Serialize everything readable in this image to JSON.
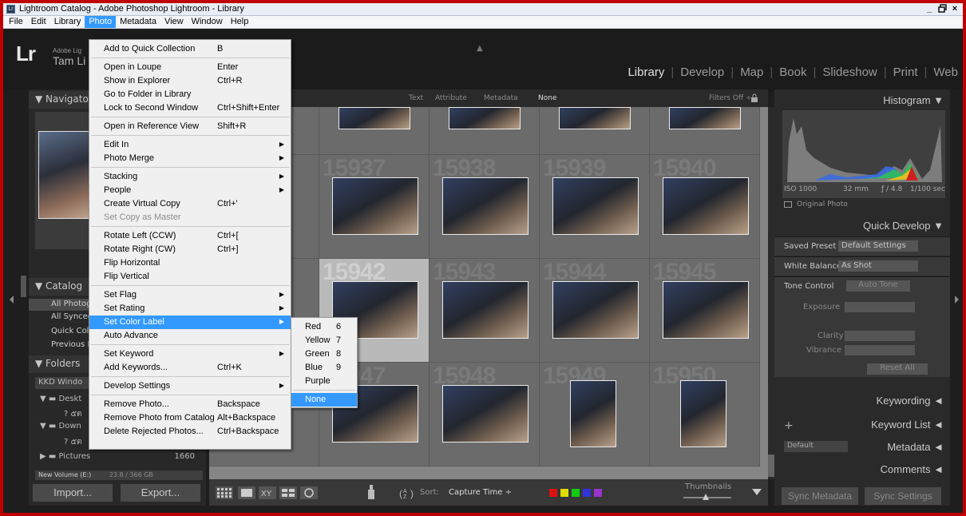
{
  "window": {
    "title": "Lightroom Catalog - Adobe Photoshop Lightroom - Library",
    "icon": "Lr",
    "controls": [
      "_",
      "×"
    ]
  },
  "menubar": [
    "File",
    "Edit",
    "Library",
    "Photo",
    "Metadata",
    "View",
    "Window",
    "Help"
  ],
  "identity": {
    "logo": "Lr",
    "line1": "Adobe Lig",
    "line2": "Tam Li"
  },
  "modules": [
    "Library",
    "Develop",
    "Map",
    "Book",
    "Slideshow",
    "Print",
    "Web"
  ],
  "left": {
    "navigator": "▼ Navigato",
    "catalog_title": "▼ Catalog",
    "catalog_items": [
      "All Photog",
      "All Synced",
      "Quick Colle",
      "Previous In"
    ],
    "folders_title": "▼ Folders",
    "folders": [
      {
        "label": "KKD Windo"
      },
      {
        "label": "▼ ▬ Deskt"
      },
      {
        "label": "? ๕ต"
      },
      {
        "label": "▼ ▬ Down"
      },
      {
        "label": "? ๕ต"
      },
      {
        "label": "▶ ▬ Pictures",
        "count": "1660"
      }
    ],
    "drive": {
      "label": "New Volume (E:)",
      "size": "23.8 / 366 GB"
    },
    "import_btn": "Import...",
    "export_btn": "Export..."
  },
  "filterbar": {
    "items": [
      "Text",
      "Attribute",
      "Metadata",
      "None"
    ],
    "filters": "Filters Off ÷"
  },
  "grid": {
    "rows": [
      [
        "15937",
        "15938",
        "15939",
        "15940"
      ],
      [
        "15942",
        "15943",
        "15944",
        "15945"
      ],
      [
        "15947",
        "15948",
        "15949",
        "15950"
      ]
    ],
    "selected": "15942"
  },
  "toolbar": {
    "sort_label": "Sort:",
    "sort_value": "Capture Time ÷",
    "thumbnails_label": "Thumbnails",
    "swatches": [
      "#d11",
      "#dd0",
      "#1c1",
      "#33d",
      "#93c"
    ]
  },
  "right": {
    "histogram": "Histogram ▼",
    "exif": [
      "ISO 1000",
      "32 mm",
      "ƒ / 4.8",
      "1/100 sec"
    ],
    "original_photo": "Original Photo",
    "quick_develop": "Quick Develop ▼",
    "saved_preset_label": "Saved Preset",
    "saved_preset_value": "Default Settings",
    "wb_label": "White Balance",
    "wb_value": "As Shot",
    "tone_label": "Tone Control",
    "auto_tone": "Auto Tone",
    "exposure": "Exposure",
    "clarity": "Clarity",
    "vibrance": "Vibrance",
    "reset": "Reset All",
    "keywording": "Keywording ◄",
    "keyword_list": "Keyword List ◄",
    "metadata_preset": "Default",
    "metadata": "Metadata ◄",
    "comments": "Comments ◄",
    "sync_metadata": "Sync Metadata",
    "sync_settings": "Sync Settings"
  },
  "photo_menu": [
    {
      "label": "Add to Quick Collection",
      "sc": "B"
    },
    {
      "sep": true
    },
    {
      "label": "Open in Loupe",
      "sc": "Enter"
    },
    {
      "label": "Show in Explorer",
      "sc": "Ctrl+R"
    },
    {
      "label": "Go to Folder in Library"
    },
    {
      "label": "Lock to Second Window",
      "sc": "Ctrl+Shift+Enter"
    },
    {
      "sep": true
    },
    {
      "label": "Open in Reference View",
      "sc": "Shift+R"
    },
    {
      "sep": true
    },
    {
      "label": "Edit In",
      "sub": true
    },
    {
      "label": "Photo Merge",
      "sub": true
    },
    {
      "sep": true
    },
    {
      "label": "Stacking",
      "sub": true
    },
    {
      "label": "People",
      "sub": true
    },
    {
      "label": "Create Virtual Copy",
      "sc": "Ctrl+'"
    },
    {
      "label": "Set Copy as Master",
      "disabled": true
    },
    {
      "sep": true
    },
    {
      "label": "Rotate Left (CCW)",
      "sc": "Ctrl+["
    },
    {
      "label": "Rotate Right (CW)",
      "sc": "Ctrl+]"
    },
    {
      "label": "Flip Horizontal"
    },
    {
      "label": "Flip Vertical"
    },
    {
      "sep": true
    },
    {
      "label": "Set Flag",
      "sub": true
    },
    {
      "label": "Set Rating",
      "sub": true
    },
    {
      "label": "Set Color Label",
      "sub": true,
      "hl": true
    },
    {
      "label": "Auto Advance"
    },
    {
      "sep": true
    },
    {
      "label": "Set Keyword",
      "sub": true
    },
    {
      "label": "Add Keywords...",
      "sc": "Ctrl+K"
    },
    {
      "sep": true
    },
    {
      "label": "Develop Settings",
      "sub": true
    },
    {
      "sep": true
    },
    {
      "label": "Remove Photo...",
      "sc": "Backspace"
    },
    {
      "label": "Remove Photo from Catalog",
      "sc": "Alt+Backspace"
    },
    {
      "label": "Delete Rejected Photos...",
      "sc": "Ctrl+Backspace"
    }
  ],
  "color_submenu": [
    {
      "label": "Red",
      "sc": "6"
    },
    {
      "label": "Yellow",
      "sc": "7"
    },
    {
      "label": "Green",
      "sc": "8"
    },
    {
      "label": "Blue",
      "sc": "9"
    },
    {
      "label": "Purple"
    },
    {
      "sep": true
    },
    {
      "label": "None",
      "hl": true
    }
  ]
}
